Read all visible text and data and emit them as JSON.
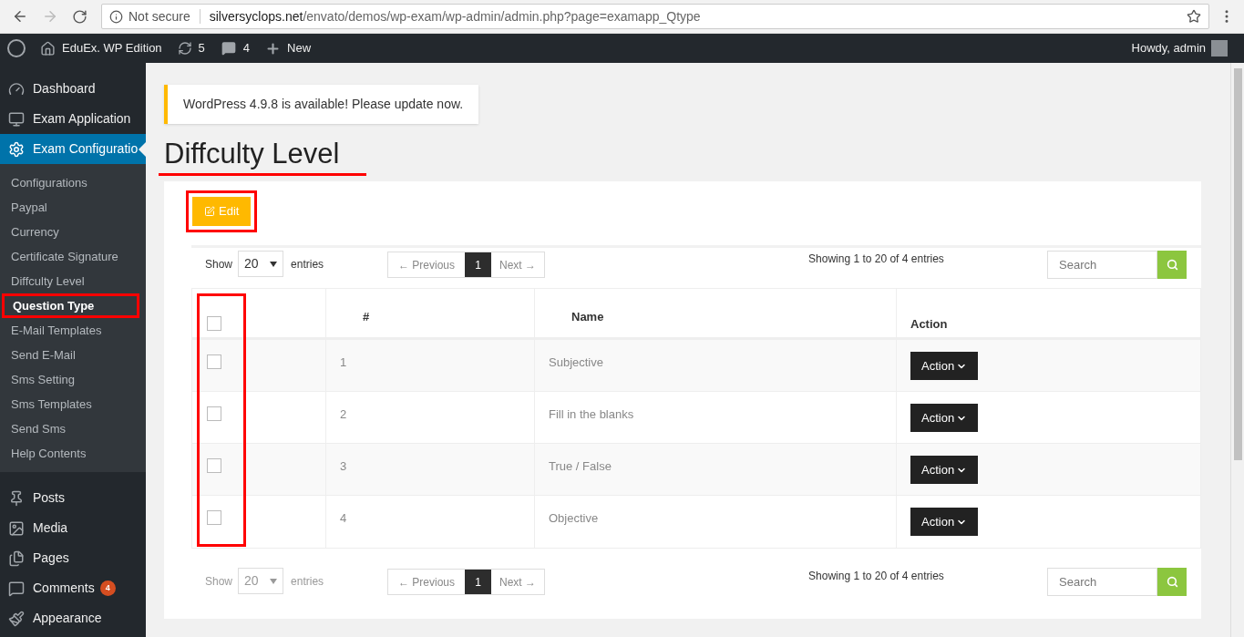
{
  "browser": {
    "security": "Not secure",
    "url_host": "silversyclops.net",
    "url_path": "/envato/demos/wp-exam/wp-admin/admin.php?page=examapp_Qtype"
  },
  "admin_bar": {
    "site": "EduEx. WP Edition",
    "updates": "5",
    "comments": "4",
    "new": "New",
    "greeting": "Howdy, admin"
  },
  "sidebar": {
    "items": [
      {
        "label": "Dashboard",
        "selected": false
      },
      {
        "label": "Exam Application",
        "selected": false
      },
      {
        "label": "Exam Configuratio",
        "selected": true,
        "children": [
          {
            "label": "Configurations",
            "selected": false,
            "highlighted": false
          },
          {
            "label": "Paypal",
            "selected": false,
            "highlighted": false
          },
          {
            "label": "Currency",
            "selected": false,
            "highlighted": false
          },
          {
            "label": "Certificate Signature",
            "selected": false,
            "highlighted": false
          },
          {
            "label": "Diffculty Level",
            "selected": false,
            "highlighted": false
          },
          {
            "label": "Question Type",
            "selected": true,
            "highlighted": true
          },
          {
            "label": "E-Mail Templates",
            "selected": false,
            "highlighted": false
          },
          {
            "label": "Send E-Mail",
            "selected": false,
            "highlighted": false
          },
          {
            "label": "Sms Setting",
            "selected": false,
            "highlighted": false
          },
          {
            "label": "Sms Templates",
            "selected": false,
            "highlighted": false
          },
          {
            "label": "Send Sms",
            "selected": false,
            "highlighted": false
          },
          {
            "label": "Help Contents",
            "selected": false,
            "highlighted": false
          }
        ]
      },
      {
        "label": "Posts",
        "selected": false
      },
      {
        "label": "Media",
        "selected": false
      },
      {
        "label": "Pages",
        "selected": false
      },
      {
        "label": "Comments",
        "selected": false,
        "badge": "4"
      },
      {
        "label": "Appearance",
        "selected": false
      }
    ]
  },
  "notice": "WordPress 4.9.8 is available! Please update now.",
  "page_title": {
    "text": "Diffculty Level",
    "underlined": true
  },
  "edit_button": {
    "label": "Edit",
    "highlighted": true
  },
  "controls": [
    {
      "show": "Show",
      "length": "20",
      "entries": "entries",
      "disabled": false,
      "previous": "← Previous",
      "page": "1",
      "next": "Next →",
      "info": "Showing 1 to 20 of 4 entries",
      "search_placeholder": "Search"
    },
    {
      "show": "Show",
      "length": "20",
      "entries": "entries",
      "disabled": true,
      "previous": "← Previous",
      "page": "1",
      "next": "Next →",
      "info": "Showing 1 to 20 of 4 entries",
      "search_placeholder": "Search"
    }
  ],
  "table": {
    "checkbox_column_highlighted": true,
    "header_checked": false,
    "columns": [
      "#",
      "Name",
      "Action"
    ],
    "rows": [
      {
        "number": "1",
        "name": "Subjective",
        "action": "Action",
        "checked": false
      },
      {
        "number": "2",
        "name": "Fill in the blanks",
        "action": "Action",
        "checked": false
      },
      {
        "number": "3",
        "name": "True / False",
        "action": "Action",
        "checked": false
      },
      {
        "number": "4",
        "name": "Objective",
        "action": "Action",
        "checked": false
      }
    ]
  }
}
